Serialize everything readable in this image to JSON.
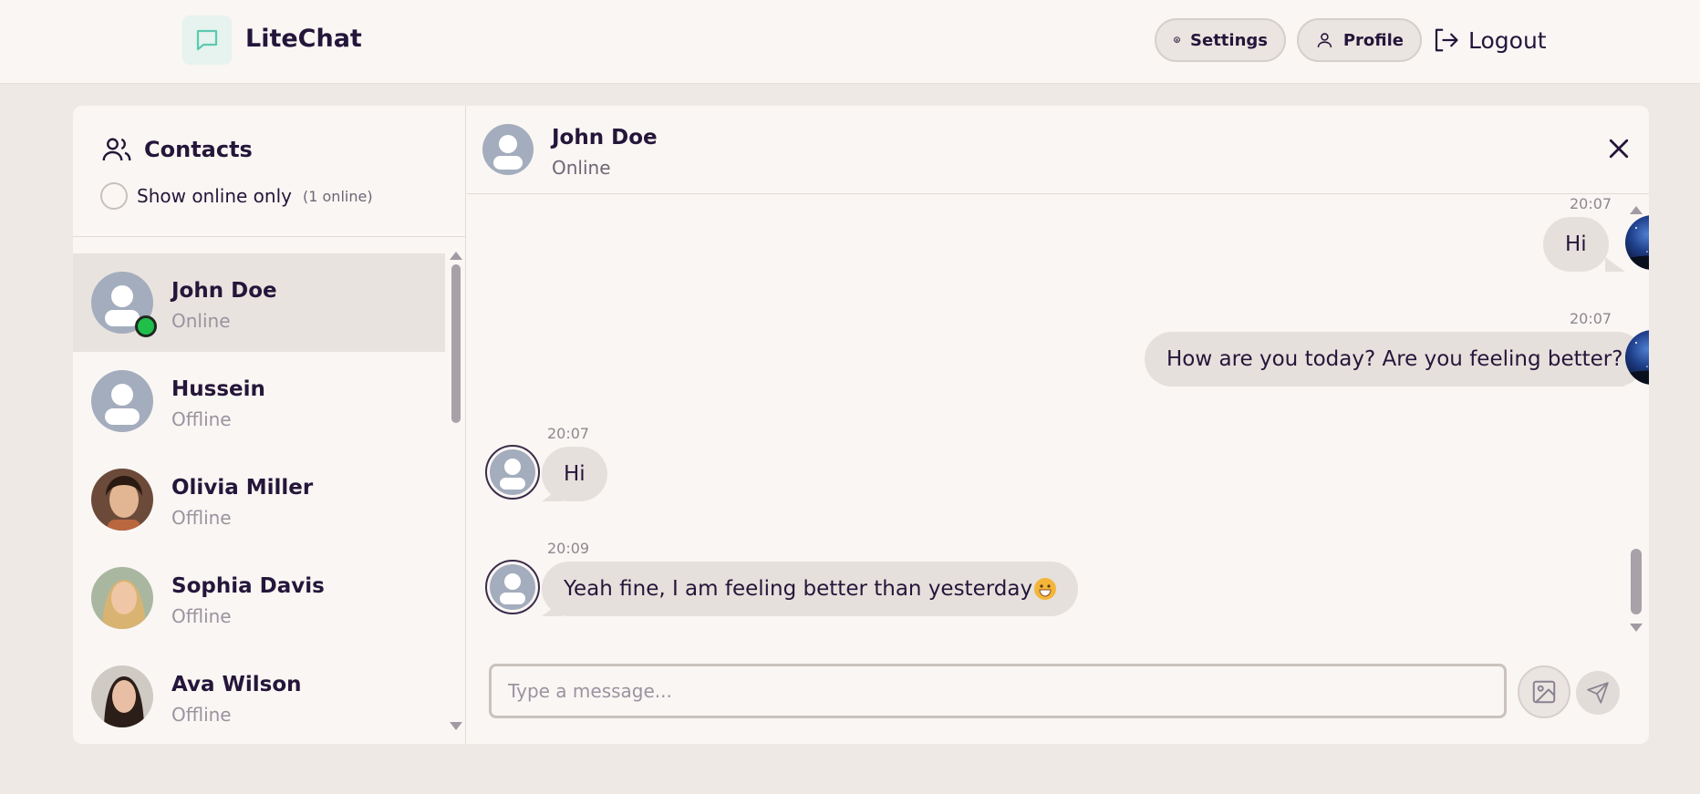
{
  "app": {
    "name": "LiteChat",
    "logo_icon": "chat-bubble-icon"
  },
  "nav": {
    "settings_label": "Settings",
    "profile_label": "Profile",
    "logout_label": "Logout"
  },
  "sidebar": {
    "title": "Contacts",
    "filter_label": "Show online only",
    "online_count": "(1 online)",
    "contacts": [
      {
        "name": "John Doe",
        "status": "Online",
        "avatar": "default-avatar",
        "active": true
      },
      {
        "name": "Hussein",
        "status": "Offline",
        "avatar": "default-avatar",
        "active": false
      },
      {
        "name": "Olivia Miller",
        "status": "Offline",
        "avatar": "photo-avatar",
        "active": false
      },
      {
        "name": "Sophia Davis",
        "status": "Offline",
        "avatar": "photo-avatar",
        "active": false
      },
      {
        "name": "Ava Wilson",
        "status": "Offline",
        "avatar": "photo-avatar",
        "active": false
      }
    ]
  },
  "chat": {
    "contact_name": "John Doe",
    "contact_status": "Online",
    "messages": [
      {
        "from": "me",
        "time": "20:07",
        "text": "Hi"
      },
      {
        "from": "me",
        "time": "20:07",
        "text": "How are you today? Are you feeling better?"
      },
      {
        "from": "them",
        "time": "20:07",
        "text": "Hi"
      },
      {
        "from": "them",
        "time": "20:09",
        "text": "Yeah fine, I am feeling better than yesterday",
        "emoji": "grinning-face"
      }
    ],
    "input_placeholder": "Type a message..."
  },
  "colors": {
    "background": "#efe9e5",
    "panel": "#faf6f3",
    "bubble": "#e6e0dc",
    "online": "#1fbf4a",
    "text": "#24163a",
    "accent": "#5ec9b0"
  }
}
